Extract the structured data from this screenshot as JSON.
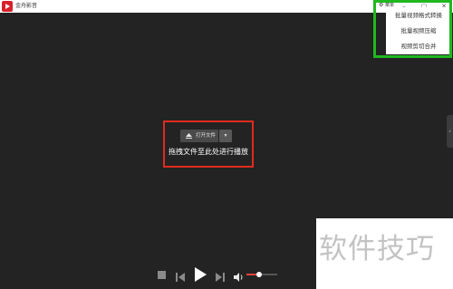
{
  "app": {
    "title": "金舟影音",
    "brand_color": "#d8202b"
  },
  "title_bar": {
    "menu_label": "菜单",
    "menu_icon": "gear-icon",
    "minimize_icon": "minimize-icon",
    "maximize_icon": "maximize-icon",
    "close_icon": "close-icon"
  },
  "dropdown_menu": {
    "items": [
      {
        "label": "批量视频格式转换"
      },
      {
        "label": "批量视频压缩"
      },
      {
        "label": "视频剪切合并"
      }
    ],
    "highlight_color": "#1fb81f"
  },
  "center": {
    "open_button_label": "打开文件",
    "open_icon": "eject-icon",
    "open_dropdown_label": "▾",
    "drop_hint": "拖拽文件至此处进行播放",
    "highlight_color": "#e12a1f"
  },
  "side_handle": {
    "icon": "chevron-left-icon",
    "glyph": "‹"
  },
  "playback": {
    "stop_icon": "stop-icon",
    "prev_icon": "skip-previous-icon",
    "play_icon": "play-icon",
    "next_icon": "skip-next-icon",
    "volume_icon": "volume-icon",
    "volume_level": 0.42,
    "accent_color": "#e2453a"
  },
  "watermark": {
    "text": "软件技巧"
  }
}
